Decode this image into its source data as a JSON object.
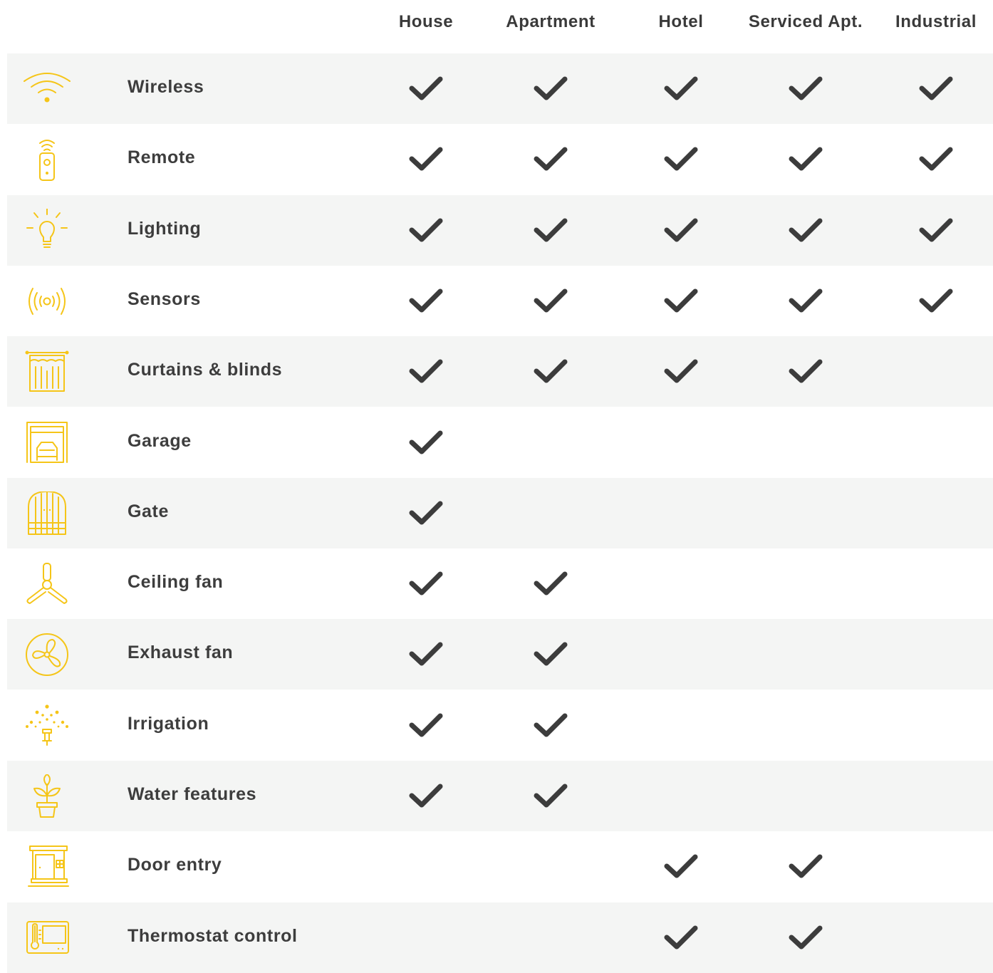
{
  "colors": {
    "accent": "#f5c518",
    "check": "#3c3c3c",
    "row_shade": "#f4f5f4",
    "text": "#3d3d3d"
  },
  "columns": [
    "House",
    "Apartment",
    "Hotel",
    "Serviced Apt.",
    "Industrial"
  ],
  "rows": [
    {
      "icon": "wifi-icon",
      "label": "Wireless",
      "checks": [
        true,
        true,
        true,
        true,
        true
      ]
    },
    {
      "icon": "remote-icon",
      "label": "Remote",
      "checks": [
        true,
        true,
        true,
        true,
        true
      ]
    },
    {
      "icon": "lightbulb-icon",
      "label": "Lighting",
      "checks": [
        true,
        true,
        true,
        true,
        true
      ]
    },
    {
      "icon": "sensor-icon",
      "label": "Sensors",
      "checks": [
        true,
        true,
        true,
        true,
        true
      ]
    },
    {
      "icon": "curtains-icon",
      "label": "Curtains & blinds",
      "checks": [
        true,
        true,
        true,
        true,
        false
      ]
    },
    {
      "icon": "garage-icon",
      "label": "Garage",
      "checks": [
        true,
        false,
        false,
        false,
        false
      ]
    },
    {
      "icon": "gate-icon",
      "label": "Gate",
      "checks": [
        true,
        false,
        false,
        false,
        false
      ]
    },
    {
      "icon": "ceiling-fan-icon",
      "label": "Ceiling fan",
      "checks": [
        true,
        true,
        false,
        false,
        false
      ]
    },
    {
      "icon": "exhaust-fan-icon",
      "label": "Exhaust fan",
      "checks": [
        true,
        true,
        false,
        false,
        false
      ]
    },
    {
      "icon": "irrigation-icon",
      "label": "Irrigation",
      "checks": [
        true,
        true,
        false,
        false,
        false
      ]
    },
    {
      "icon": "plant-icon",
      "label": "Water features",
      "checks": [
        true,
        true,
        false,
        false,
        false
      ]
    },
    {
      "icon": "door-entry-icon",
      "label": "Door entry",
      "checks": [
        false,
        false,
        true,
        true,
        false
      ]
    },
    {
      "icon": "thermostat-icon",
      "label": "Thermostat control",
      "checks": [
        false,
        false,
        true,
        true,
        false
      ]
    }
  ]
}
